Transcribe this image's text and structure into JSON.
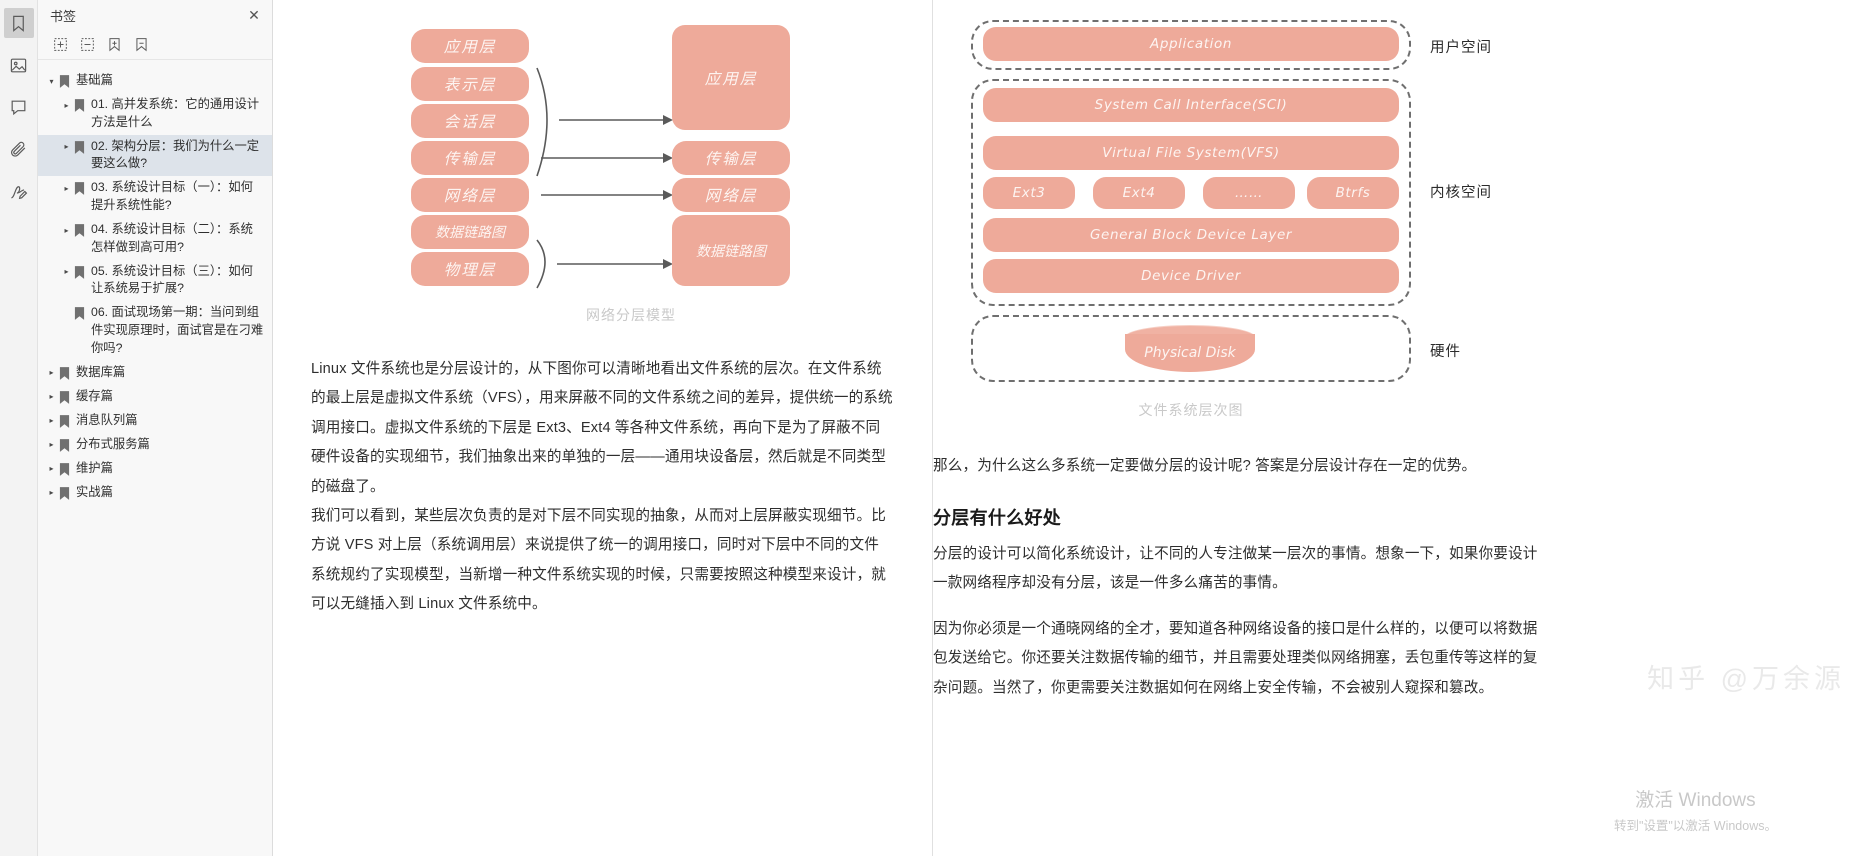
{
  "rail": {
    "items": [
      {
        "name": "bookmark-icon",
        "active": true
      },
      {
        "name": "thumbnails-icon",
        "active": false
      },
      {
        "name": "comment-icon",
        "active": false
      },
      {
        "name": "attachment-icon",
        "active": false
      },
      {
        "name": "signature-icon",
        "active": false
      }
    ]
  },
  "sidebar": {
    "title": "书签",
    "close_label": "✕",
    "toolbar": [
      {
        "name": "expand-all-button",
        "label": "⊞"
      },
      {
        "name": "collapse-all-button",
        "label": "⊟"
      },
      {
        "name": "add-bookmark-button",
        "label": "⊕"
      },
      {
        "name": "delete-bookmark-button",
        "label": "⊖"
      }
    ],
    "tree": [
      {
        "level": 0,
        "twisty": "▾",
        "label": "基础篇",
        "selected": false
      },
      {
        "level": 1,
        "twisty": "▸",
        "label": "01. 高并发系统：它的通用设计方法是什么",
        "selected": false
      },
      {
        "level": 1,
        "twisty": "▸",
        "label": "02. 架构分层：我们为什么一定要这么做?",
        "selected": true
      },
      {
        "level": 1,
        "twisty": "▸",
        "label": "03. 系统设计目标（一）：如何提升系统性能?",
        "selected": false
      },
      {
        "level": 1,
        "twisty": "▸",
        "label": "04. 系统设计目标（二）：系统怎样做到高可用?",
        "selected": false
      },
      {
        "level": 1,
        "twisty": "▸",
        "label": "05. 系统设计目标（三）：如何让系统易于扩展?",
        "selected": false
      },
      {
        "level": 1,
        "twisty": "",
        "label": "06. 面试现场第一期：当问到组件实现原理时，面试官是在刁难你吗?",
        "selected": false
      },
      {
        "level": 0,
        "twisty": "▸",
        "label": "数据库篇",
        "selected": false
      },
      {
        "level": 0,
        "twisty": "▸",
        "label": "缓存篇",
        "selected": false
      },
      {
        "level": 0,
        "twisty": "▸",
        "label": "消息队列篇",
        "selected": false
      },
      {
        "level": 0,
        "twisty": "▸",
        "label": "分布式服务篇",
        "selected": false
      },
      {
        "level": 0,
        "twisty": "▸",
        "label": "维护篇",
        "selected": false
      },
      {
        "level": 0,
        "twisty": "▸",
        "label": "实战篇",
        "selected": false
      }
    ]
  },
  "left_page": {
    "figure": {
      "caption": "网络分层模型",
      "left_stack": [
        "应用层",
        "表示层",
        "会话层",
        "传输层",
        "网络层",
        "数据链路图",
        "物理层"
      ],
      "right_stack": [
        "应用层",
        "传输层",
        "网络层",
        "数据链路图"
      ]
    },
    "paragraphs": [
      "Linux 文件系统也是分层设计的，从下图你可以清晰地看出文件系统的层次。在文件系统的最上层是虚拟文件系统（VFS），用来屏蔽不同的文件系统之间的差异，提供统一的系统调用接口。虚拟文件系统的下层是 Ext3、Ext4 等各种文件系统，再向下是为了屏蔽不同硬件设备的实现细节，我们抽象出来的单独的一层——通用块设备层，然后就是不同类型的磁盘了。",
      "我们可以看到，某些层次负责的是对下层不同实现的抽象，从而对上层屏蔽实现细节。比方说 VFS 对上层（系统调用层）来说提供了统一的调用接口，同时对下层中不同的文件系统规约了实现模型，当新增一种文件系统实现的时候，只需要按照这种模型来设计，就可以无缝插入到 Linux 文件系统中。"
    ]
  },
  "right_page": {
    "figure": {
      "caption": "文件系统层次图",
      "user_space_label": "用户空间",
      "kernel_space_label": "内核空间",
      "hardware_label": "硬件",
      "application": "Application",
      "sci": "System Call Interface(SCI)",
      "vfs": "Virtual File System(VFS)",
      "filesystems": [
        "Ext3",
        "Ext4",
        "……",
        "Btrfs"
      ],
      "block_layer": "General Block Device Layer",
      "device_driver": "Device Driver",
      "physical_disk": "Physical Disk"
    },
    "intro": "那么，为什么这么多系统一定要做分层的设计呢? 答案是分层设计存在一定的优势。",
    "heading": "分层有什么好处",
    "paragraphs": [
      "分层的设计可以简化系统设计，让不同的人专注做某一层次的事情。",
      "想象一下，如果你要设计一款网络程序却没有分层，该是一件多么痛苦的事情。",
      "因为你必须是一个通晓网络的全才，要知道各种网络设备的接口是什么样的，以便可以将数据包发送给它。你还要关注数据传输的细节，并且需要处理类似网络拥塞，丢包重传等这样的复杂问题。当然了，你更需要关注数据如何在网络上安全传输，不会被别人窥探和篡改。"
    ]
  },
  "overlays": {
    "watermark": "知乎 @万余源",
    "activate_title": "激活 Windows",
    "activate_sub": "转到\"设置\"以激活 Windows。"
  },
  "colors": {
    "accent": "#eeaa9a",
    "selection": "#dde3ea",
    "sidebar_bg": "#f8f8f8",
    "rail_bg": "#f3f3f3"
  }
}
